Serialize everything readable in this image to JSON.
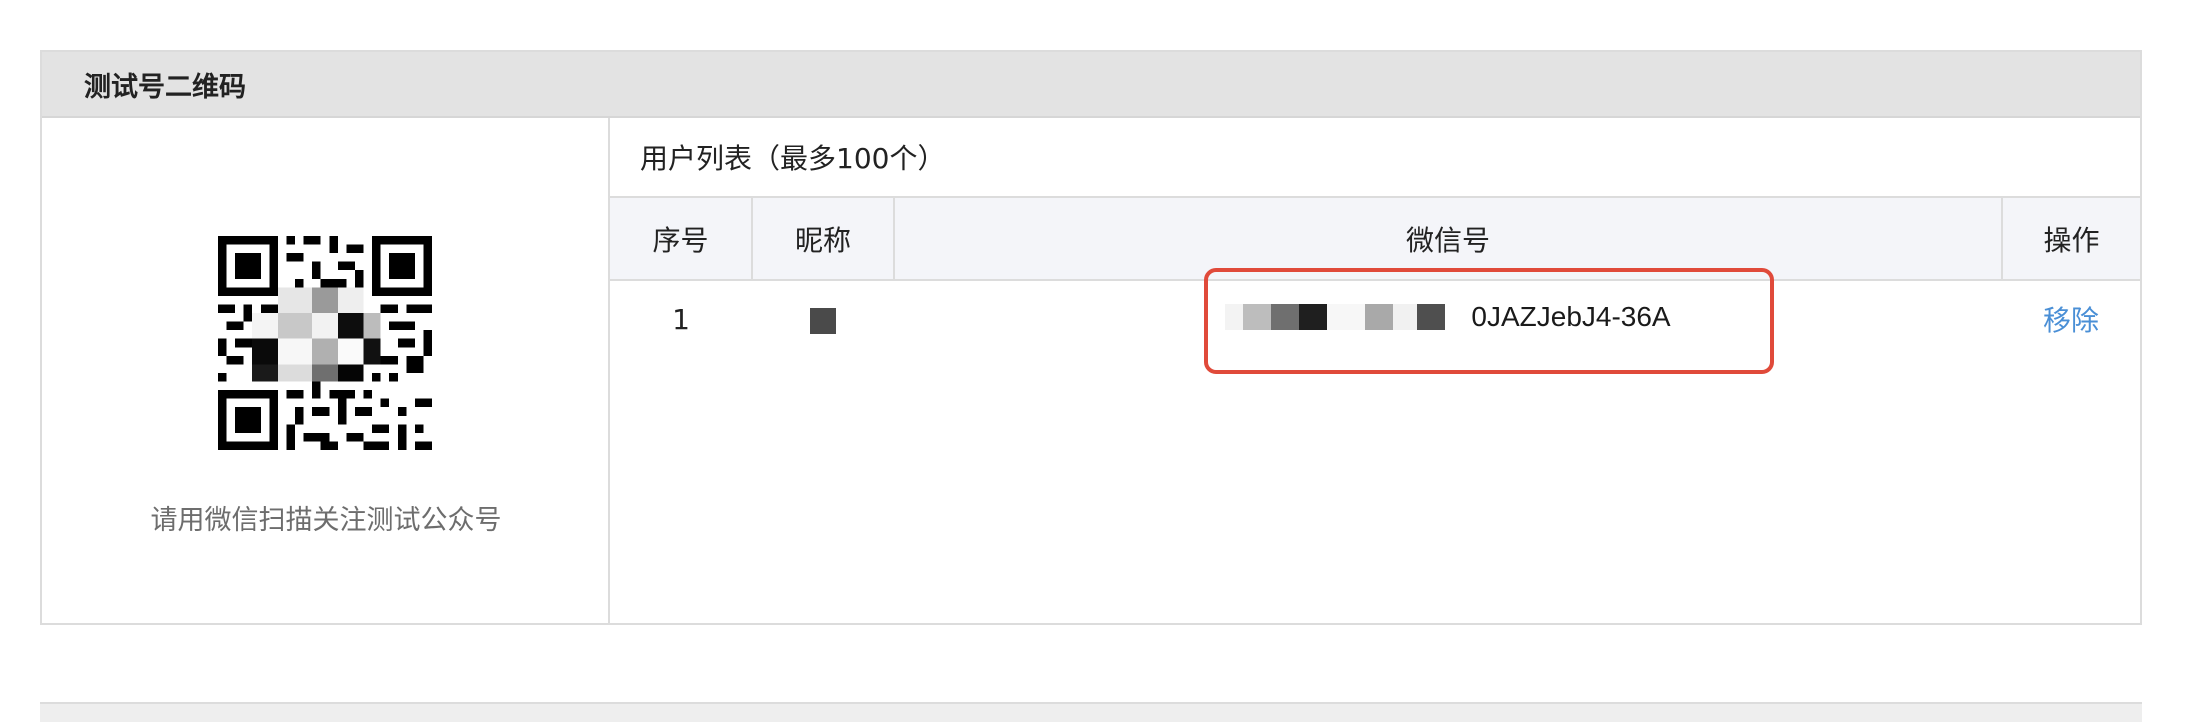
{
  "panel": {
    "title": "测试号二维码"
  },
  "qr": {
    "caption": "请用微信扫描关注测试公众号"
  },
  "user_list": {
    "title": "用户列表（最多100个）",
    "columns": [
      "序号",
      "昵称",
      "微信号",
      "操作"
    ],
    "rows": [
      {
        "index": "1",
        "wechat_id_visible": "0JAZJebJ4-36A",
        "action": "移除"
      }
    ]
  },
  "colors": {
    "header_bg": "#e3e3e3",
    "table_header_bg": "#f4f5f9",
    "link": "#4a8fd6",
    "highlight": "#e04a3a"
  }
}
